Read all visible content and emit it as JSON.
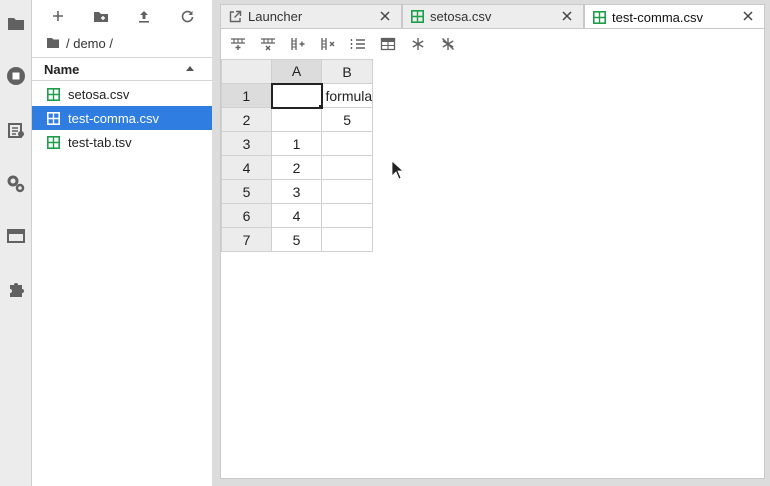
{
  "file_browser": {
    "breadcrumb": "/ demo /",
    "header_name": "Name",
    "items": [
      {
        "label": "setosa.csv",
        "selected": false
      },
      {
        "label": "test-comma.csv",
        "selected": true
      },
      {
        "label": "test-tab.tsv",
        "selected": false
      }
    ]
  },
  "tabs": [
    {
      "label": "Launcher",
      "icon": "launcher-icon",
      "active": false
    },
    {
      "label": "setosa.csv",
      "icon": "spreadsheet-icon",
      "active": false
    },
    {
      "label": "test-comma.csv",
      "icon": "spreadsheet-icon",
      "active": true
    }
  ],
  "grid": {
    "columns": [
      "A",
      "B"
    ],
    "rows": [
      {
        "num": "1",
        "cells": [
          "",
          "formula"
        ]
      },
      {
        "num": "2",
        "cells": [
          "",
          "5"
        ]
      },
      {
        "num": "3",
        "cells": [
          "1",
          ""
        ]
      },
      {
        "num": "4",
        "cells": [
          "2",
          ""
        ]
      },
      {
        "num": "5",
        "cells": [
          "3",
          ""
        ]
      },
      {
        "num": "6",
        "cells": [
          "4",
          ""
        ]
      },
      {
        "num": "7",
        "cells": [
          "5",
          ""
        ]
      }
    ]
  },
  "colors": {
    "selection": "#2f7de1",
    "spreadsheet_icon": "#1e9e4a",
    "icon_gray": "#616161"
  }
}
